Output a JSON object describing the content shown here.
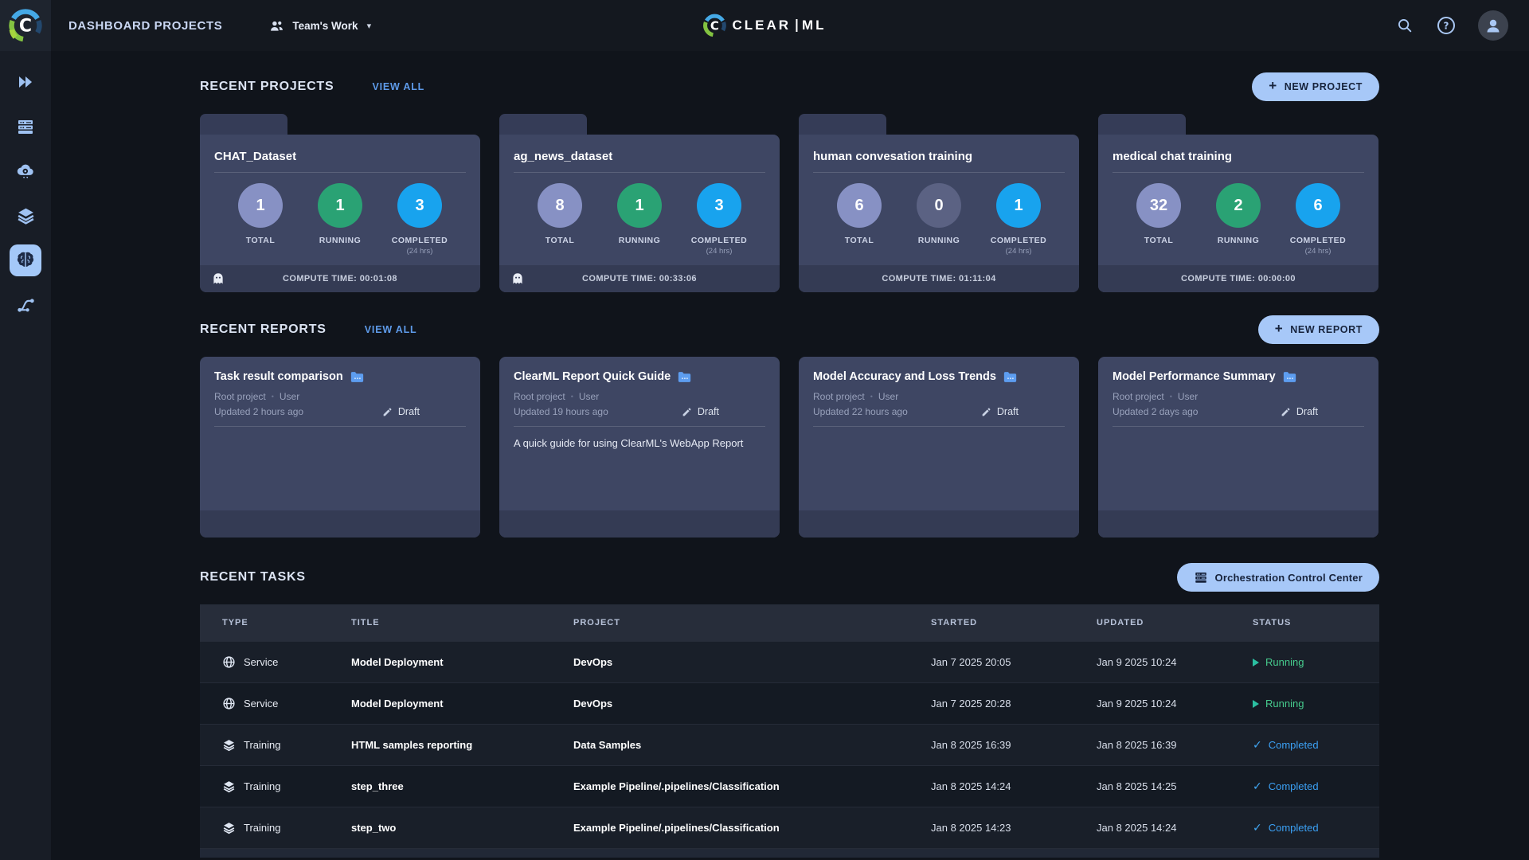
{
  "glyphs": {
    "plus": "+",
    "caret": "▾",
    "dot": "•",
    "question": "?",
    "check": "✓",
    "logo_letter": "C"
  },
  "topbar": {
    "title": "DASHBOARD PROJECTS",
    "workspace": "Team's Work",
    "logo_clear": "CLEAR",
    "logo_ml": "ML"
  },
  "projects": {
    "heading": "RECENT PROJECTS",
    "view_all": "VIEW ALL",
    "new_button": "NEW PROJECT",
    "stat_labels": {
      "total": "TOTAL",
      "running": "RUNNING",
      "completed": "COMPLETED",
      "window": "(24 hrs)"
    },
    "cards": [
      {
        "name": "CHAT_Dataset",
        "total": "1",
        "running": "1",
        "completed": "3",
        "compute": "COMPUTE TIME: 00:01:08"
      },
      {
        "name": "ag_news_dataset",
        "total": "8",
        "running": "1",
        "completed": "3",
        "compute": "COMPUTE TIME: 00:33:06"
      },
      {
        "name": "human convesation training",
        "total": "6",
        "running": "0",
        "completed": "1",
        "compute": "COMPUTE TIME: 01:11:04"
      },
      {
        "name": "medical chat training",
        "total": "32",
        "running": "2",
        "completed": "6",
        "compute": "COMPUTE TIME: 00:00:00"
      }
    ]
  },
  "reports": {
    "heading": "RECENT REPORTS",
    "view_all": "VIEW ALL",
    "new_button": "NEW REPORT",
    "cards": [
      {
        "title": "Task result comparison",
        "project": "Root project",
        "author": "User",
        "updated": "Updated 2 hours ago",
        "badge": "Draft",
        "description": ""
      },
      {
        "title": "ClearML Report Quick Guide",
        "project": "Root project",
        "author": "User",
        "updated": "Updated 19 hours ago",
        "badge": "Draft",
        "description": "A quick guide for using ClearML's WebApp Report"
      },
      {
        "title": "Model Accuracy and Loss Trends",
        "project": "Root project",
        "author": "User",
        "updated": "Updated 22 hours ago",
        "badge": "Draft",
        "description": ""
      },
      {
        "title": "Model Performance Summary",
        "project": "Root project",
        "author": "User",
        "updated": "Updated 2 days ago",
        "badge": "Draft",
        "description": ""
      }
    ]
  },
  "tasks": {
    "heading": "RECENT TASKS",
    "button": "Orchestration Control Center",
    "columns": {
      "type": "TYPE",
      "title": "TITLE",
      "project": "PROJECT",
      "started": "STARTED",
      "updated": "UPDATED",
      "status": "STATUS"
    },
    "rows": [
      {
        "type": "Service",
        "title": "Model Deployment",
        "project": "DevOps",
        "started": "Jan 7 2025 20:05",
        "updated": "Jan 9 2025 10:24",
        "status": "Running"
      },
      {
        "type": "Service",
        "title": "Model Deployment",
        "project": "DevOps",
        "started": "Jan 7 2025 20:28",
        "updated": "Jan 9 2025 10:24",
        "status": "Running"
      },
      {
        "type": "Training",
        "title": "HTML samples reporting",
        "project": "Data Samples",
        "started": "Jan 8 2025 16:39",
        "updated": "Jan 8 2025 16:39",
        "status": "Completed"
      },
      {
        "type": "Training",
        "title": "step_three",
        "project": "Example Pipeline/.pipelines/Classification",
        "started": "Jan 8 2025 14:24",
        "updated": "Jan 8 2025 14:25",
        "status": "Completed"
      },
      {
        "type": "Training",
        "title": "step_two",
        "project": "Example Pipeline/.pipelines/Classification",
        "started": "Jan 8 2025 14:23",
        "updated": "Jan 8 2025 14:24",
        "status": "Completed"
      }
    ]
  },
  "colors": {
    "background": "#10141b",
    "topbar": "#14181f",
    "sidebar": "#181d26",
    "card": "#3e4663",
    "card_footer": "#343b54",
    "accent_button": "#a7c8f8",
    "link_blue": "#5e9bea",
    "total_circle": "#8791c4",
    "running_circle": "#2aa274",
    "running_zero_circle": "#5b6283",
    "completed_circle": "#18a3ee",
    "status_running": "#46cb8d",
    "status_completed": "#3ba0f4"
  }
}
